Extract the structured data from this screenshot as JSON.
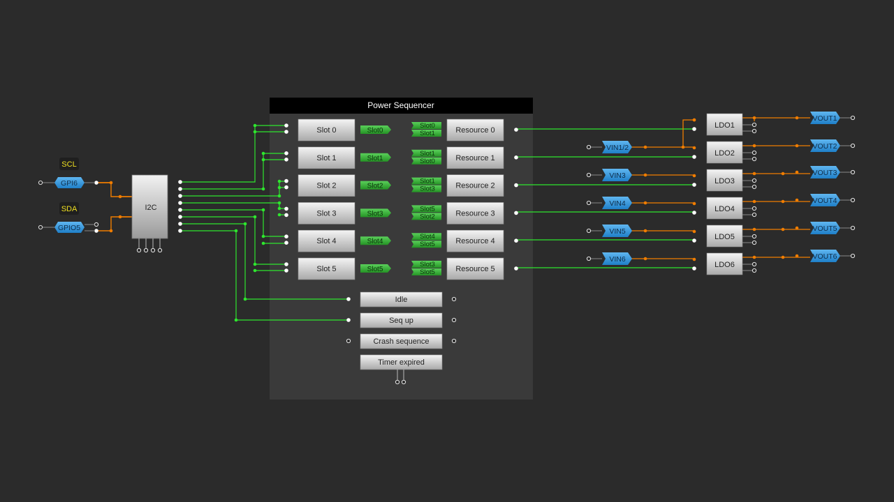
{
  "io_labels": {
    "scl": "SCL",
    "sda": "SDA"
  },
  "pins": {
    "gpi6": "GPI6",
    "gpio5": "GPIO5"
  },
  "i2c": {
    "label": "I2C"
  },
  "sequencer": {
    "title": "Power Sequencer",
    "slots": [
      "Slot 0",
      "Slot 1",
      "Slot 2",
      "Slot 3",
      "Slot 4",
      "Slot 5"
    ],
    "slot_tags": [
      "Slot0",
      "Slot1",
      "Slot2",
      "Slot3",
      "Slot4",
      "Slot5"
    ],
    "resource_tags": [
      [
        "Slot0",
        "Slot1"
      ],
      [
        "Slot1",
        "Slot0"
      ],
      [
        "Slot1",
        "Slot3"
      ],
      [
        "Slot5",
        "Slot2"
      ],
      [
        "Slot4",
        "Slot5"
      ],
      [
        "Slot3",
        "Slot5"
      ]
    ],
    "resources": [
      "Resource 0",
      "Resource 1",
      "Resource 2",
      "Resource 3",
      "Resource 4",
      "Resource 5"
    ],
    "controls": [
      "Idle",
      "Seq up",
      "Crash sequence",
      "Timer expired"
    ]
  },
  "vins": [
    "VIN1/2",
    "VIN3",
    "VIN4",
    "VIN5",
    "VIN6"
  ],
  "ldos": [
    "LDO1",
    "LDO2",
    "LDO3",
    "LDO4",
    "LDO5",
    "LDO6"
  ],
  "vouts": [
    "VOUT1",
    "VOUT2",
    "VOUT3",
    "VOUT4",
    "VOUT5",
    "VOUT6"
  ],
  "colors": {
    "background": "#2b2b2b",
    "panel": "#3a3a3a",
    "panel_header": "#000000",
    "green_wire": "#2ee62e",
    "orange_wire": "#f07d00",
    "tag_green": "#35b035",
    "pin_blue": "#2b8fd9",
    "label_yellow": "#f0e020"
  }
}
